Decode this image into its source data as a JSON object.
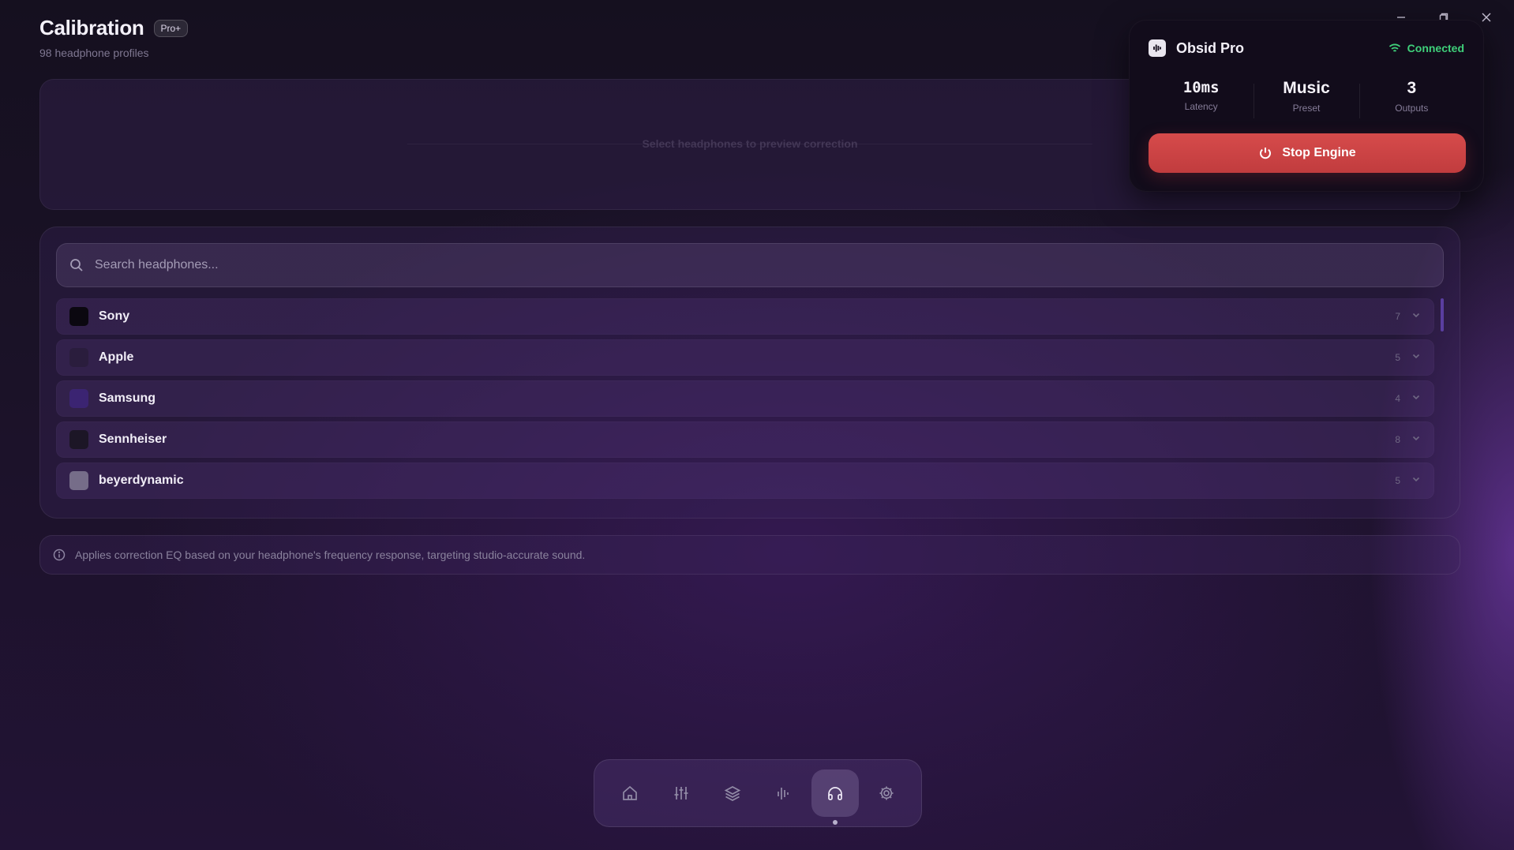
{
  "header": {
    "title": "Calibration",
    "badge": "Pro+",
    "subtitle": "98 headphone profiles"
  },
  "preview": {
    "hint": "Select headphones to preview correction"
  },
  "search": {
    "placeholder": "Search headphones...",
    "value": ""
  },
  "brands": [
    {
      "name": "Sony",
      "count": "7",
      "color": "#0b0810"
    },
    {
      "name": "Apple",
      "count": "5",
      "color": "#2a1d3d"
    },
    {
      "name": "Samsung",
      "count": "4",
      "color": "#3b2472"
    },
    {
      "name": "Sennheiser",
      "count": "8",
      "color": "#1c1626"
    },
    {
      "name": "beyerdynamic",
      "count": "5",
      "color": "#766d89"
    }
  ],
  "info": {
    "text": "Applies correction EQ based on your headphone's frequency response, targeting studio-accurate sound."
  },
  "device": {
    "name": "Obsid Pro",
    "status": "Connected",
    "stats": [
      {
        "value": "10ms",
        "label": "Latency"
      },
      {
        "value": "Music",
        "label": "Preset"
      },
      {
        "value": "3",
        "label": "Outputs"
      }
    ],
    "action_label": "Stop Engine"
  },
  "dock": {
    "items": [
      "home-icon",
      "mixer-icon",
      "layers-icon",
      "waveform-icon",
      "headphones-icon",
      "gear-icon"
    ],
    "active": "headphones-icon"
  },
  "colors": {
    "accent": "#5a3ea0",
    "status_ok": "#3fd07a",
    "danger": "#d64b4b"
  }
}
